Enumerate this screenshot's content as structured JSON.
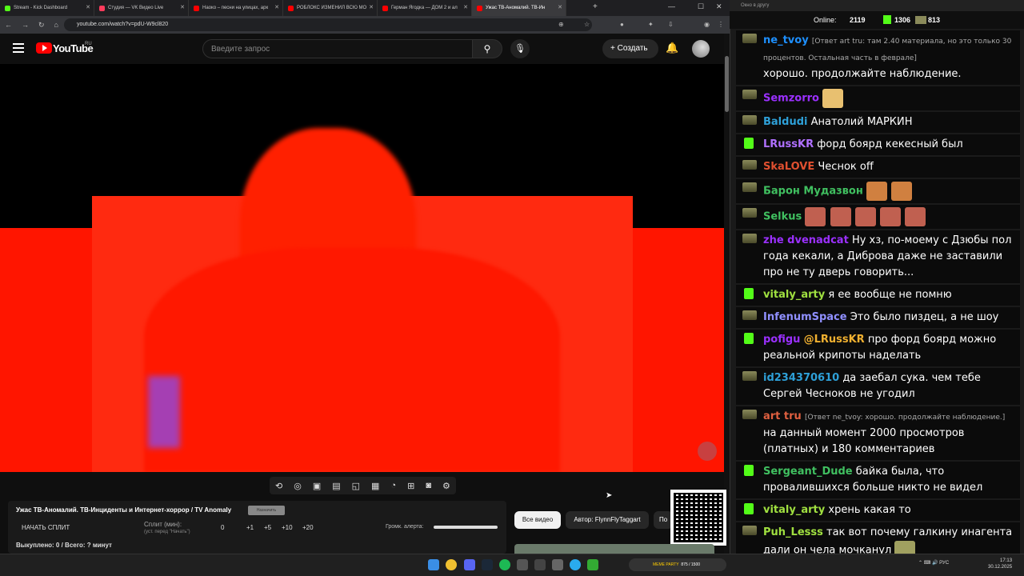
{
  "tabs": [
    {
      "label": "Stream - Kick Dashboard",
      "color": "#53fc18"
    },
    {
      "label": "Студия — VK Видео Live",
      "color": "#ff3b5c"
    },
    {
      "label": "Наоко – песни на улицах, арк",
      "color": "#ff0000"
    },
    {
      "label": "РОБЛОКС ИЗМЕНИЛ ВСЮ МО",
      "color": "#ff0000"
    },
    {
      "label": "Герман Ягодка — ДОМ 2 и ал",
      "color": "#ff0000"
    },
    {
      "label": "Ужас ТВ-Аномалий. ТВ-Ин",
      "color": "#ff0000"
    }
  ],
  "url": "youtube.com/watch?v=pdU-W9cl820",
  "youtube": {
    "logo": "YouTube",
    "region": "RU",
    "search_placeholder": "Введите запрос",
    "create_label": "Создать"
  },
  "video_panel": {
    "title": "Ужас ТВ-Аномалий. ТВ-Инциденты и Интернет-хоррор / TV Anomaly",
    "badge": "Назначить",
    "start_split": "НАЧАТЬ СПЛИТ",
    "split_label": "Сплит (мин):",
    "split_hint": "(уст. перед \"Начать\")",
    "split_value": "0",
    "plus1": "+1",
    "plus5": "+5",
    "plus10": "+10",
    "plus20": "+20",
    "volume_label": "Громк. алерта:",
    "bought": "Выкуплено: 0 / Всего: ? минут"
  },
  "chips": {
    "all": "Все видео",
    "author": "Автор: FlynnFlyTaggart",
    "more": "По"
  },
  "meme": {
    "label": "MEME PARTY",
    "progress": "875 / 1500"
  },
  "clock": {
    "time": "17:13",
    "date": "30.12.2025",
    "lang": "РУС"
  },
  "chat": {
    "title": "Окно в другу",
    "online_label": "Online:",
    "online": "2119",
    "kick_count": "1306",
    "vk_count": "813",
    "messages": [
      {
        "user": "ne_tvoy",
        "color": "#1e90ff",
        "badge": "tv",
        "reply": "[Ответ art tru: там 2.40 материала, но это только 30 процентов. Остальная часть в феврале]",
        "text": "хорошо. продолжайте наблюдение."
      },
      {
        "user": "Semzorro",
        "color": "#9b30ff",
        "badge": "tv",
        "text": "",
        "emotes": [
          "#e8c070"
        ]
      },
      {
        "user": "Baldudi",
        "color": "#2ea0d8",
        "badge": "tv",
        "text": "Анатолий МАРКИН"
      },
      {
        "user": "LRussKR",
        "color": "#b070ff",
        "badge": "k",
        "text": "форд боярд кекесный был"
      },
      {
        "user": "SkaLOVE",
        "color": "#e05030",
        "badge": "tv",
        "text": "Чеснок off"
      },
      {
        "user": "Барон Мудазвон",
        "color": "#40c060",
        "badge": "tv",
        "text": "",
        "emotes": [
          "#d08040",
          "#d08040"
        ]
      },
      {
        "user": "Selkus",
        "color": "#40c060",
        "badge": "tv",
        "text": "",
        "emotes": [
          "#c06050",
          "#c06050",
          "#c06050",
          "#c06050",
          "#c06050"
        ]
      },
      {
        "user": "zhe dvenadcat",
        "color": "#9b30ff",
        "badge": "tv",
        "text": "Ну хз, по-моему с Дзюбы пол года кекали, а Диброва даже не заставили про не ту дверь говорить..."
      },
      {
        "user": "vitaly_arty",
        "color": "#a0e040",
        "badge": "k",
        "text": "я ее вообще не помню"
      },
      {
        "user": "InfenumSpace",
        "color": "#9090ff",
        "badge": "tv",
        "text": "Это было пиздец, а не шоу"
      },
      {
        "user": "pofigu",
        "color": "#9b30ff",
        "badge": "k",
        "mention": "@LRussKR",
        "text": "про форд боярд можно реальной крипоты наделать"
      },
      {
        "user": "id234370610",
        "color": "#2ea0d8",
        "badge": "tv",
        "text": "да заебал сука. чем тебе Сергей Чесноков не угодил"
      },
      {
        "user": "art tru",
        "color": "#e06040",
        "badge": "tv",
        "reply": "[Ответ ne_tvoy: хорошо. продолжайте наблюдение.]",
        "text": "на данный момент 2000 просмотров (платных) и 180 комментариев"
      },
      {
        "user": "Sergeant_Dude",
        "color": "#40c060",
        "badge": "k",
        "text": "байка была, что провалившихся больше никто не видел"
      },
      {
        "user": "vitaly_arty",
        "color": "#a0e040",
        "badge": "k",
        "text": "хрень какая то"
      },
      {
        "user": "Puh_Lesss",
        "color": "#a0e040",
        "badge": "tv",
        "text": "так вот почему галкину инагента дали он чела мочканул",
        "emotes": [
          "#a0a060"
        ]
      }
    ]
  }
}
